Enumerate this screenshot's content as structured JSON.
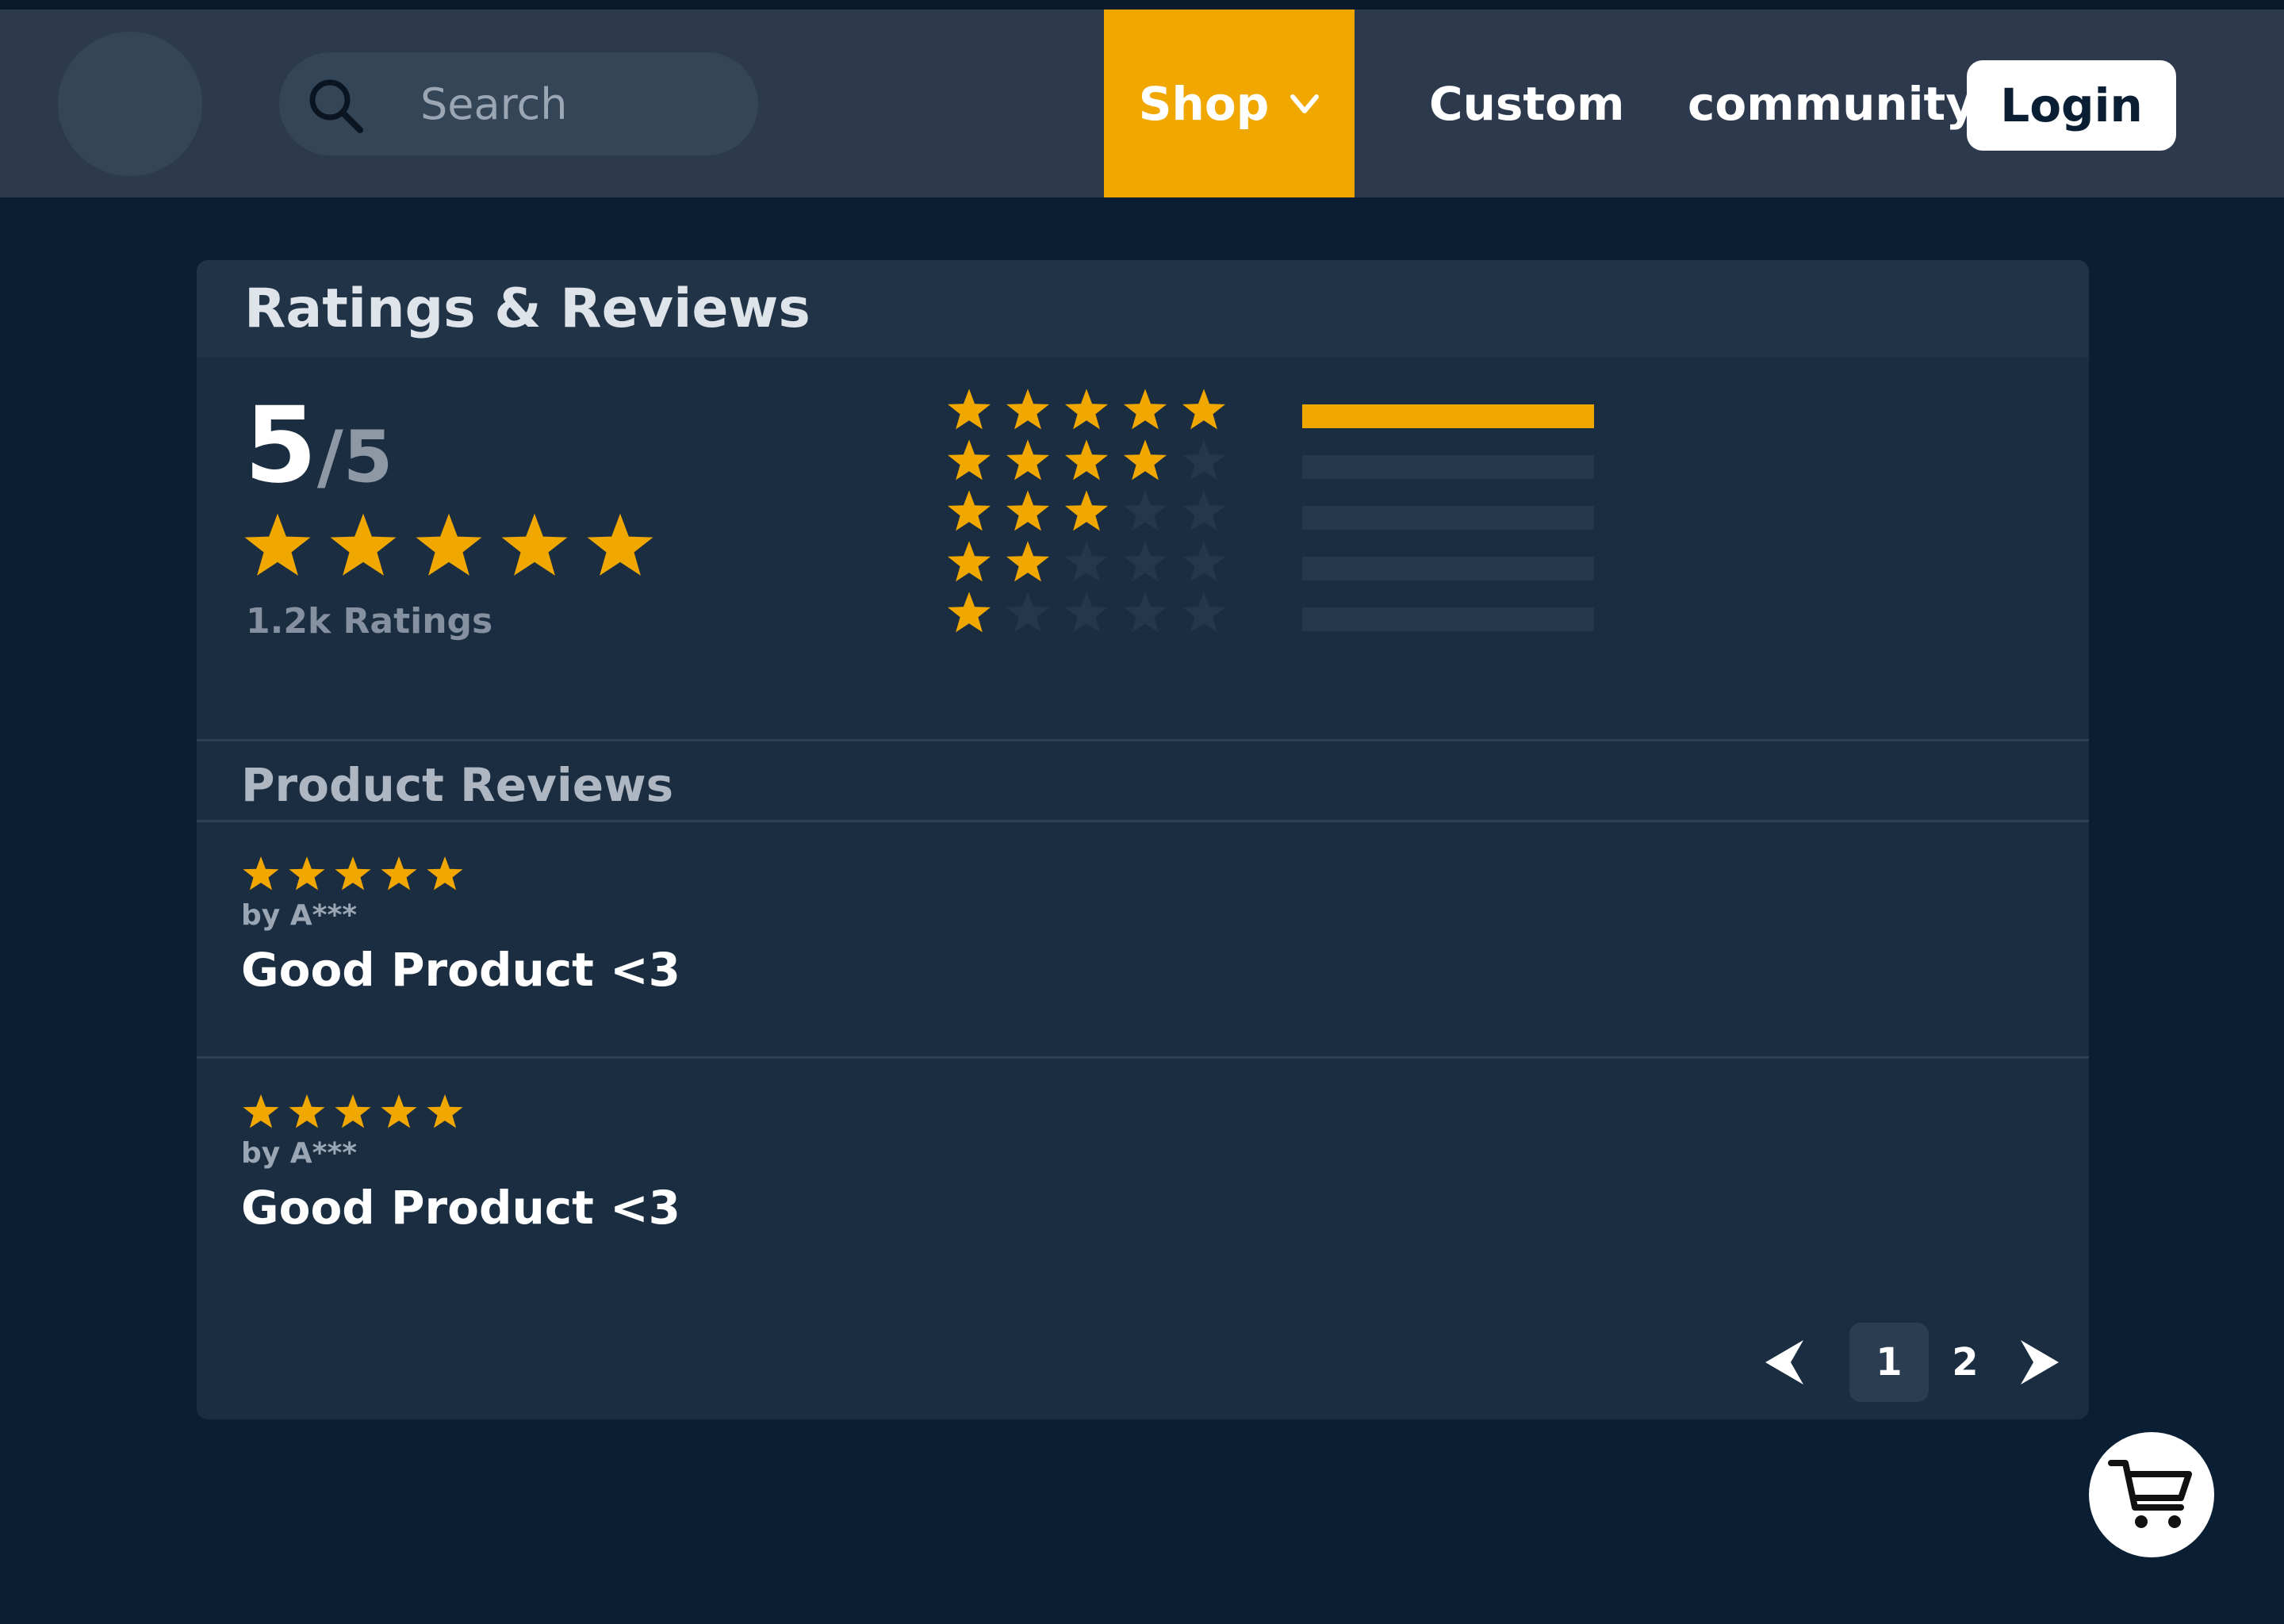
{
  "navbar": {
    "search_placeholder": "Search",
    "shop_label": "Shop",
    "custom_label": "Custom",
    "community_label": "community",
    "login_label": "Login"
  },
  "colors": {
    "accent": "#f0a700",
    "background": "#0a1f33",
    "card": "#1a2d41",
    "navbar": "#2d3a4d"
  },
  "ratings": {
    "title": "Ratings & Reviews",
    "score": "5",
    "score_max": "/5",
    "stars": 5,
    "count_text": "1.2k Ratings",
    "distribution": [
      {
        "stars": 5,
        "fraction": 1.0
      },
      {
        "stars": 4,
        "fraction": 0.0
      },
      {
        "stars": 3,
        "fraction": 0.0
      },
      {
        "stars": 2,
        "fraction": 0.0
      },
      {
        "stars": 1,
        "fraction": 0.0
      }
    ]
  },
  "reviews": {
    "title": "Product Reviews",
    "items": [
      {
        "stars": 5,
        "author": "by A***",
        "text": "Good Product <3"
      },
      {
        "stars": 5,
        "author": "by A***",
        "text": "Good Product <3"
      }
    ]
  },
  "pagination": {
    "pages": [
      "1",
      "2"
    ],
    "current": "1",
    "prev_icon": "chevron-left-icon",
    "next_icon": "chevron-right-icon"
  },
  "icons": {
    "search": "search-icon",
    "dropdown": "chevron-down-icon",
    "cart": "cart-icon"
  }
}
